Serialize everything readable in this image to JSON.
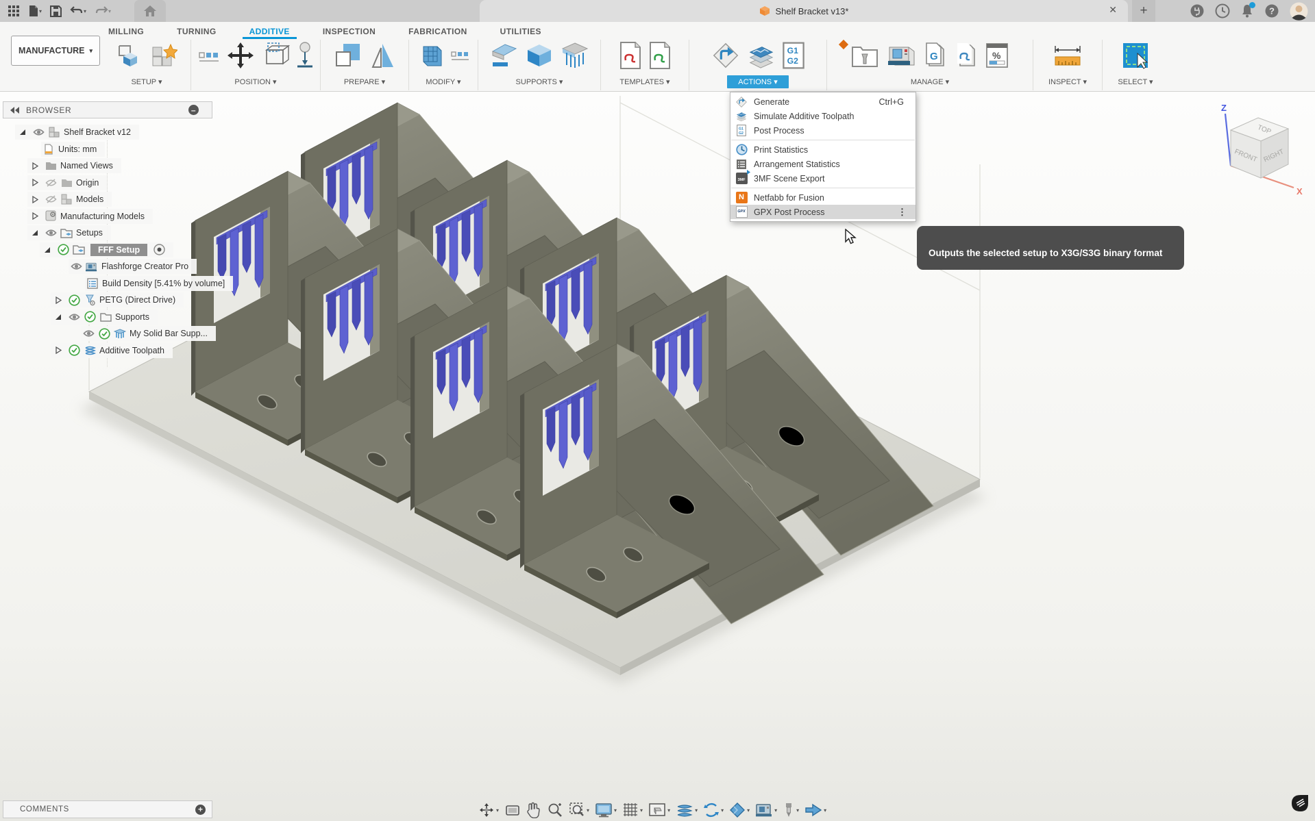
{
  "titlebar": {
    "title": "Shelf Bracket v13*"
  },
  "workspace": {
    "label": "MANUFACTURE",
    "caret": "▾"
  },
  "tabs": [
    {
      "label": "MILLING"
    },
    {
      "label": "TURNING"
    },
    {
      "label": "ADDITIVE",
      "active": true
    },
    {
      "label": "INSPECTION"
    },
    {
      "label": "FABRICATION"
    },
    {
      "label": "UTILITIES"
    }
  ],
  "ribbon": {
    "groups": [
      {
        "label": "SETUP ▾"
      },
      {
        "label": "POSITION ▾"
      },
      {
        "label": "PREPARE ▾"
      },
      {
        "label": "MODIFY ▾"
      },
      {
        "label": "SUPPORTS ▾"
      },
      {
        "label": "TEMPLATES ▾"
      },
      {
        "label": "ACTIONS ▾",
        "active": true
      },
      {
        "label": "MANAGE ▾"
      },
      {
        "label": "INSPECT ▾"
      },
      {
        "label": "SELECT ▾"
      }
    ]
  },
  "browser": {
    "header": "BROWSER",
    "items": [
      {
        "label": "Shelf Bracket v12"
      },
      {
        "label": "Units: mm"
      },
      {
        "label": "Named Views"
      },
      {
        "label": "Origin"
      },
      {
        "label": "Models"
      },
      {
        "label": "Manufacturing Models"
      },
      {
        "label": "Setups"
      },
      {
        "label": "FFF Setup",
        "selected": true
      },
      {
        "label": "Flashforge Creator Pro"
      },
      {
        "label": "Build Density [5.41% by volume]"
      },
      {
        "label": "PETG (Direct Drive)"
      },
      {
        "label": "Supports"
      },
      {
        "label": "My Solid Bar Supp..."
      },
      {
        "label": "Additive Toolpath"
      }
    ]
  },
  "actions_menu": {
    "items": [
      {
        "label": "Generate",
        "shortcut": "Ctrl+G"
      },
      {
        "label": "Simulate Additive Toolpath"
      },
      {
        "label": "Post Process"
      },
      {
        "label": "Print Statistics"
      },
      {
        "label": "Arrangement Statistics"
      },
      {
        "label": "3MF Scene Export"
      },
      {
        "label": "Netfabb for Fusion"
      },
      {
        "label": "GPX Post Process",
        "hovered": true
      }
    ]
  },
  "icon_texts": {
    "g1": "G1",
    "g2": "G2",
    "g": "G",
    "percent": "%",
    "threeMF": "3MF",
    "n": "N",
    "gpx": "GPX"
  },
  "tooltip": {
    "text": "Outputs the selected setup to X3G/S3G binary format"
  },
  "viewcube": {
    "top": "TOP",
    "front": "FRONT",
    "right": "RIGHT",
    "z_axis": "Z",
    "x_axis": "X"
  },
  "comments": {
    "label": "COMMENTS"
  },
  "colors": {
    "accent_blue": "#0a96d6",
    "actions_button": "#2e9fd8",
    "support_blue": "#5559c8",
    "netfabb_orange": "#e97618",
    "tooltip_bg": "#4d4d4d",
    "selected_row": "#8f8f8f",
    "bracket_gray": "#6f6f61"
  }
}
